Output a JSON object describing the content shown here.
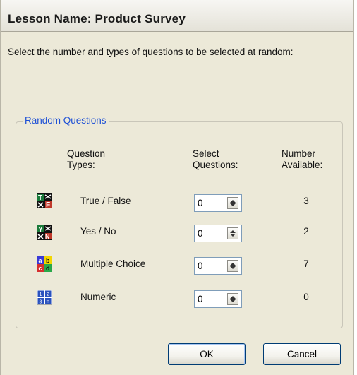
{
  "window": {
    "title": "Lesson Name: Product Survey"
  },
  "instruction": "Select the number and types of questions to be selected at random:",
  "group": {
    "label": "Random Questions",
    "headers": {
      "types_line1": "Question",
      "types_line2": "Types:",
      "select_line1": "Select",
      "select_line2": "Questions:",
      "available_line1": "Number",
      "available_line2": "Available:"
    },
    "rows": [
      {
        "label": "True / False",
        "value": "0",
        "available": "3",
        "icon": "true-false-icon"
      },
      {
        "label": "Yes / No",
        "value": "0",
        "available": "2",
        "icon": "yes-no-icon"
      },
      {
        "label": "Multiple Choice",
        "value": "0",
        "available": "7",
        "icon": "multiple-choice-icon"
      },
      {
        "label": "Numeric",
        "value": "0",
        "available": "0",
        "icon": "numeric-icon"
      }
    ]
  },
  "buttons": {
    "ok": "OK",
    "cancel": "Cancel"
  },
  "colors": {
    "group_label": "#1c4fd6",
    "dialog_bg": "#ece9d8"
  }
}
